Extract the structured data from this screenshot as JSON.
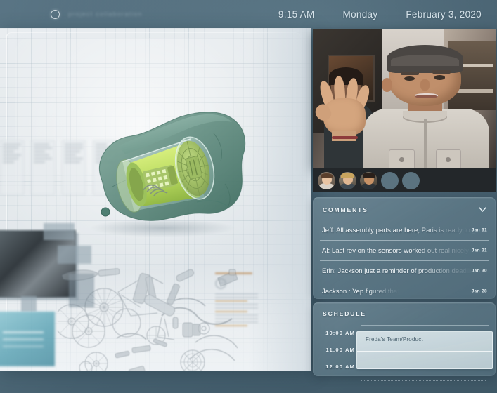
{
  "statusbar": {
    "app_icon": "circle-icon",
    "ghost_label": "project collaboration",
    "time": "9:15 AM",
    "weekday": "Monday",
    "date": "February 3, 2020"
  },
  "canvas": {
    "name": "cad-whiteboard",
    "model_name": "3d-cad-assembly-model",
    "model_colors": {
      "shell": "#5e8a7d",
      "core": "#b7d95e",
      "ring": "#8aa85a"
    },
    "parts_diagram_name": "exploded-bicycle-parts-diagram"
  },
  "video": {
    "name": "video-call-feed",
    "speaker": "active-speaker",
    "participants": [
      {
        "name": "participant-avatar-1",
        "state": "active"
      },
      {
        "name": "participant-avatar-2",
        "state": "active"
      },
      {
        "name": "participant-avatar-3",
        "state": "active"
      },
      {
        "name": "participant-avatar-4",
        "state": "empty"
      },
      {
        "name": "participant-avatar-5",
        "state": "empty"
      }
    ]
  },
  "comments": {
    "title": "COMMENTS",
    "collapse_icon": "chevron-down-icon",
    "items": [
      {
        "author": "Jeff:",
        "text": "All assembly parts are here, Paris is ready to go o",
        "date": "Jan 31"
      },
      {
        "author": "Al:",
        "text": "Last rev on the sensors worked out real nicely loo",
        "date": "Jan 31"
      },
      {
        "author": "Erin:",
        "text": "Jackson just a reminder of production deadlines",
        "date": "Jan 30"
      },
      {
        "author": "Jackson :",
        "text": "Yep figured that..",
        "date": "Jan 28"
      }
    ]
  },
  "schedule": {
    "title": "SCHEDULE",
    "times": [
      "10:00 AM",
      "11:00 AM",
      "12:00 AM"
    ],
    "event": {
      "title": "Freda's Team/Product"
    }
  },
  "theme": {
    "background": "#4e6878",
    "panel_glass": "#7e98a4",
    "board": "#e4e9ec",
    "text_light": "#f2f7fa",
    "model_green": "#5e8a7d"
  }
}
